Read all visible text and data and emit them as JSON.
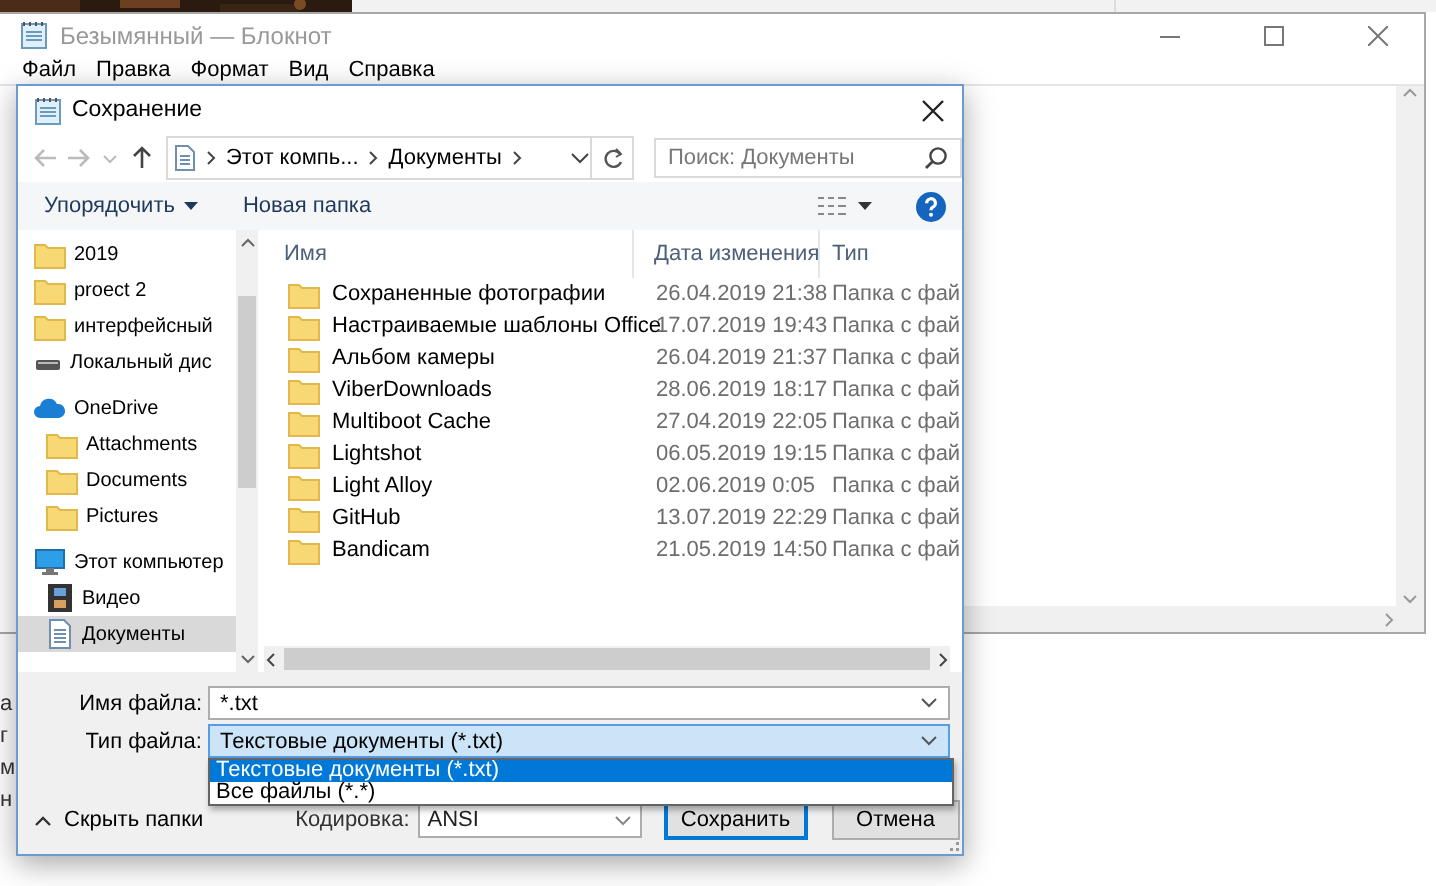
{
  "notepad": {
    "title": "Безымянный — Блокнот",
    "menu": [
      "Файл",
      "Правка",
      "Формат",
      "Вид",
      "Справка"
    ]
  },
  "behind_window": {
    "lines": [
      "а",
      "г",
      "м",
      "н"
    ]
  },
  "dialog": {
    "title": "Сохранение",
    "address": {
      "path": [
        "Этот компь...",
        "Документы"
      ]
    },
    "search": {
      "placeholder": "Поиск: Документы"
    },
    "toolbar": {
      "organize": "Упорядочить",
      "new_folder": "Новая папка"
    },
    "sidebar": {
      "items": [
        {
          "label": "2019",
          "kind": "folder",
          "selected": false
        },
        {
          "label": "proect 2",
          "kind": "folder",
          "selected": false
        },
        {
          "label": "интерфейсный",
          "kind": "folder",
          "selected": false
        },
        {
          "label": "Локальный дис",
          "kind": "drive",
          "selected": false
        },
        {
          "label": "OneDrive",
          "kind": "cloud",
          "selected": false,
          "children": [
            {
              "label": "Attachments",
              "kind": "folder",
              "selected": false
            },
            {
              "label": "Documents",
              "kind": "folder",
              "selected": false
            },
            {
              "label": "Pictures",
              "kind": "folder",
              "selected": false
            }
          ]
        },
        {
          "label": "Этот компьютер",
          "kind": "computer",
          "selected": false,
          "children": [
            {
              "label": "Видео",
              "kind": "video",
              "selected": false
            },
            {
              "label": "Документы",
              "kind": "documents",
              "selected": true
            }
          ]
        }
      ]
    },
    "files": {
      "columns": [
        "Имя",
        "Дата изменения",
        "Тип"
      ],
      "rows": [
        {
          "name": "Сохраненные фотографии",
          "date": "26.04.2019 21:38",
          "type": "Папка с фай"
        },
        {
          "name": "Настраиваемые шаблоны Office",
          "date": "17.07.2019 19:43",
          "type": "Папка с фай"
        },
        {
          "name": "Альбом камеры",
          "date": "26.04.2019 21:37",
          "type": "Папка с фай"
        },
        {
          "name": "ViberDownloads",
          "date": "28.06.2019 18:17",
          "type": "Папка с фай"
        },
        {
          "name": "Multiboot Cache",
          "date": "27.04.2019 22:05",
          "type": "Папка с фай"
        },
        {
          "name": "Lightshot",
          "date": "06.05.2019 19:15",
          "type": "Папка с фай"
        },
        {
          "name": "Light Alloy",
          "date": "02.06.2019 0:05",
          "type": "Папка с фай"
        },
        {
          "name": "GitHub",
          "date": "13.07.2019 22:29",
          "type": "Папка с фай"
        },
        {
          "name": "Bandicam",
          "date": "21.05.2019 14:50",
          "type": "Папка с фай"
        }
      ]
    },
    "filename": {
      "label": "Имя файла:",
      "value": "*.txt"
    },
    "filetype": {
      "label": "Тип файла:",
      "value": "Текстовые документы (*.txt)",
      "expanded": true,
      "options": [
        {
          "label": "Текстовые документы (*.txt)",
          "selected": true
        },
        {
          "label": "Все файлы  (*.*)",
          "selected": false
        }
      ]
    },
    "hide_folders": "Скрыть папки",
    "encoding": {
      "label": "Кодировка:",
      "value": "ANSI"
    },
    "buttons": [
      "Сохранить",
      "Отмена"
    ]
  }
}
